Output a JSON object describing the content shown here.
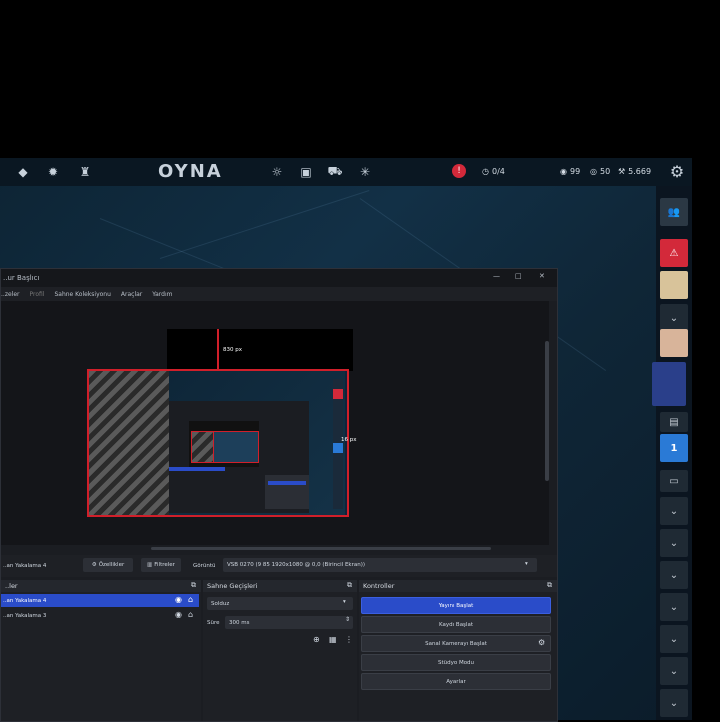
{
  "game": {
    "play_label": "OYNA",
    "alert_value": "!",
    "points_label": "0/4",
    "currency_a": "99",
    "currency_b": "50",
    "currency_c": "5.669"
  },
  "obs": {
    "window_title": "..ur Başlıcı",
    "menu": [
      "..zeler",
      "Profil",
      "Sahne Koleksiyonu",
      "Araçlar",
      "Yardım"
    ],
    "preview_label_top": "830 px",
    "preview_label_right": "16 px",
    "toolbar": {
      "source_name": "..an Yakalama 4",
      "properties_label": "Özellikler",
      "filters_label": "Filtreler",
      "display_label": "Görüntü",
      "display_value": "VSB 0270 (9 85 1920x1080 @ 0,0 (Birincil Ekran))"
    },
    "sources_header": "..ler",
    "sources": [
      {
        "name": "..an Yakalama 4"
      },
      {
        "name": "..an Yakalama 3"
      }
    ],
    "transition_header": "Sahne Geçişleri",
    "transition_value": "Solduz",
    "duration_label": "Süre",
    "duration_value": "300 ms",
    "controls_header": "Kontroller",
    "controls": [
      "Yayını Başlat",
      "Kaydı Başlat",
      "Sanal Kamerayı Başlat",
      "Stüdyo Modu",
      "Ayarlar"
    ]
  },
  "colors": {
    "accent": "#2a4cc9",
    "alert": "#d3293a",
    "selection_border": "#d11f2a"
  }
}
